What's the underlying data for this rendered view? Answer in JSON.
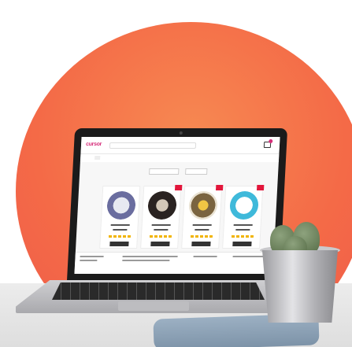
{
  "scene": {
    "background_color": "#ffffff",
    "accent_circle_color": "#f46a47"
  },
  "website": {
    "logo_text": "cursor",
    "brand_color": "#d62d7a",
    "icons": [
      "search-icon",
      "cart-icon",
      "user-icon"
    ],
    "products": [
      {
        "id": "product-1",
        "accent": "#6a6d9f"
      },
      {
        "id": "product-2",
        "accent": "#2a2321"
      },
      {
        "id": "product-3",
        "accent": "#f1c644"
      },
      {
        "id": "product-4",
        "accent": "#3fb9da"
      }
    ]
  }
}
